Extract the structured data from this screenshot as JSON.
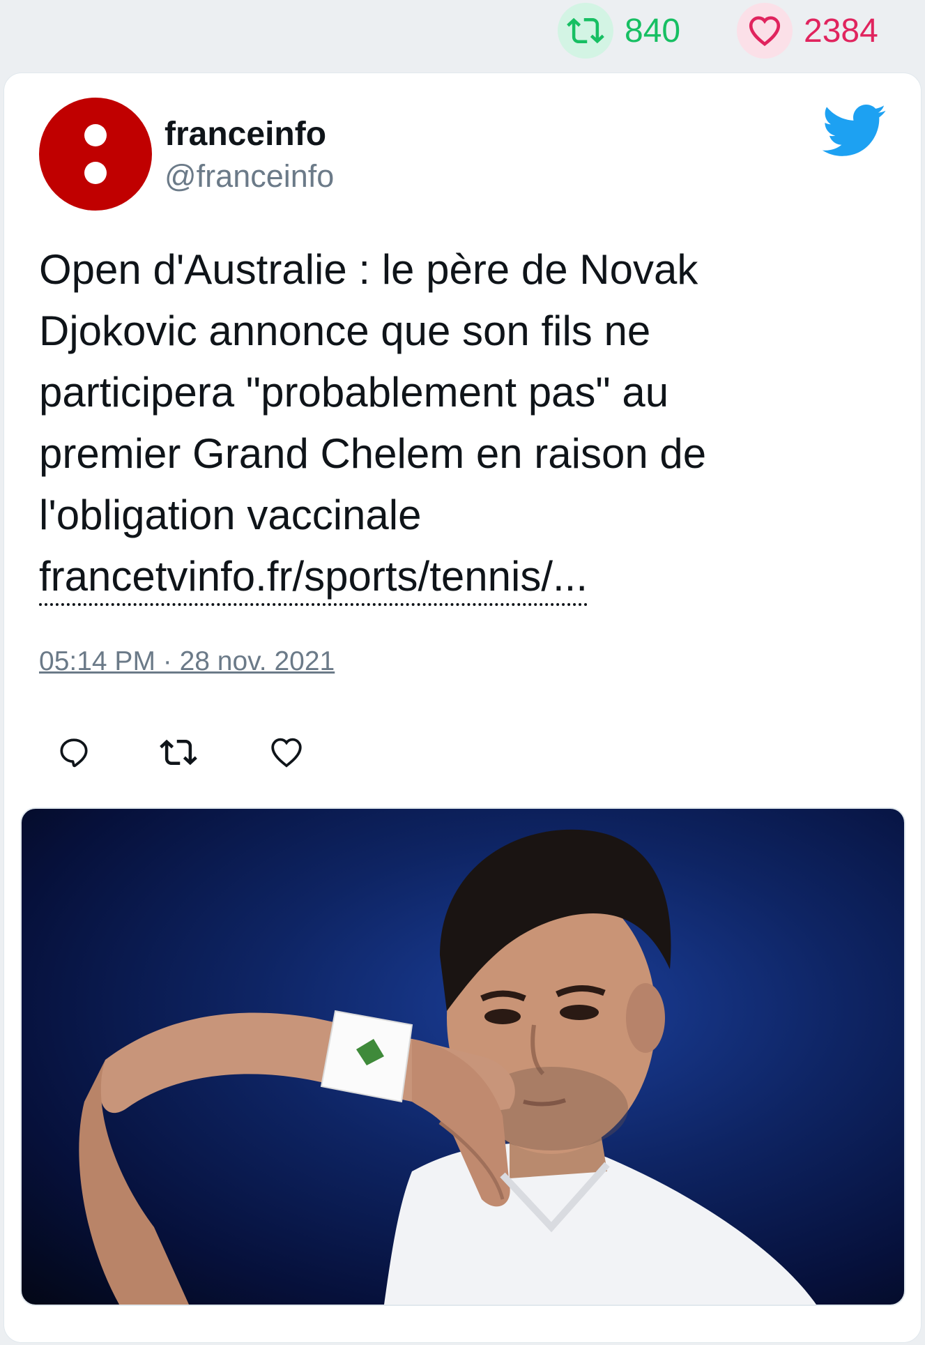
{
  "stats": {
    "retweets": "840",
    "likes": "2384",
    "retweet_color": "#17bf63",
    "like_color": "#e0245e"
  },
  "tweet": {
    "author_name": "franceinfo",
    "author_handle": "@franceinfo",
    "text_lines": [
      "Open d'Australie : le père de Novak",
      "Djokovic annonce que son fils ne",
      "participera \"probablement pas\" au",
      "premier Grand Chelem en raison de",
      "l'obligation vaccinale"
    ],
    "link": "francetvinfo.fr/sports/tennis/...",
    "timestamp": "05:14 PM · 28 nov. 2021"
  },
  "icons": {
    "top_retweet": "retweet-icon",
    "top_like": "heart-icon",
    "brand": "twitter-bird-icon",
    "reply": "reply-icon",
    "retweet": "retweet-icon",
    "like": "like-icon"
  },
  "colors": {
    "avatar": "#c00000",
    "twitter_blue": "#1da1f2"
  }
}
